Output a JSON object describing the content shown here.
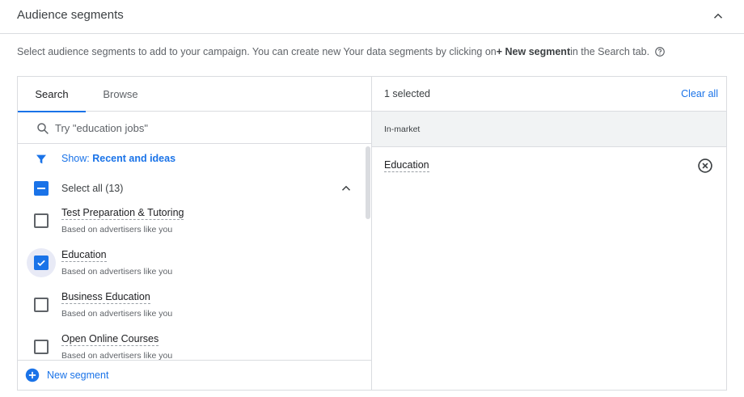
{
  "header": {
    "title": "Audience segments",
    "collapse_icon": "chevron-up-icon"
  },
  "description": {
    "text_before": "Select audience segments to add to your campaign. You can create new Your data segments by clicking on ",
    "bold": "+ New segment",
    "text_after": " in the Search tab.",
    "help_icon": "help-circle-icon"
  },
  "tabs": [
    {
      "label": "Search",
      "active": true
    },
    {
      "label": "Browse",
      "active": false
    }
  ],
  "search": {
    "placeholder": "Try \"education jobs\"",
    "value": ""
  },
  "filter": {
    "label": "Show: ",
    "value": "Recent and ideas"
  },
  "select_all": {
    "label": "Select all (13)",
    "state": "indeterminate"
  },
  "segments": [
    {
      "name": "Test Preparation & Tutoring",
      "sub": "Based on advertisers like you",
      "checked": false
    },
    {
      "name": "Education",
      "sub": "Based on advertisers like you",
      "checked": true
    },
    {
      "name": "Business Education",
      "sub": "Based on advertisers like you",
      "checked": false
    },
    {
      "name": "Open Online Courses",
      "sub": "Based on advertisers like you",
      "checked": false
    }
  ],
  "new_segment": {
    "label": "New segment"
  },
  "selected_panel": {
    "count_label": "1 selected",
    "clear_label": "Clear all",
    "group_label": "In-market",
    "items": [
      {
        "name": "Education"
      }
    ]
  },
  "colors": {
    "accent": "#1a73e8",
    "border": "#dadce0",
    "text": "#3c4043",
    "muted": "#5f6368"
  }
}
